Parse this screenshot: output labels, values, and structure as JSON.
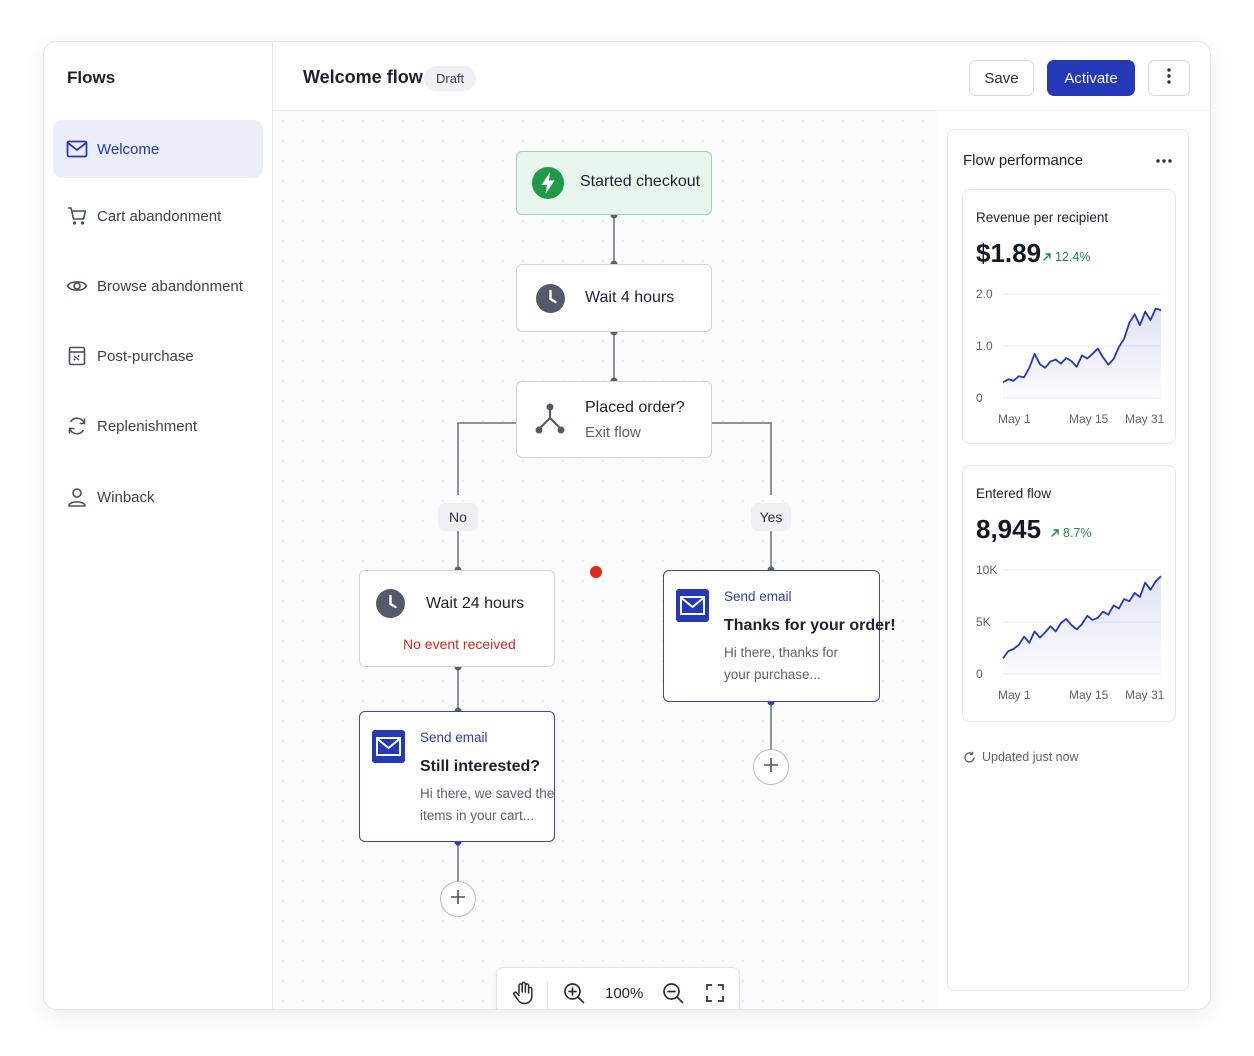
{
  "sidebar": {
    "title": "Flows",
    "items": [
      {
        "label": "Welcome",
        "icon": "mail-icon",
        "active": true
      },
      {
        "label": "Cart abandonment",
        "icon": "cart-icon"
      },
      {
        "label": "Browse abandonment",
        "icon": "eye-icon"
      },
      {
        "label": "Post-purchase",
        "icon": "receipt-icon"
      },
      {
        "label": "Replenishment",
        "icon": "refresh-icon"
      },
      {
        "label": "Winback",
        "icon": "user-icon"
      }
    ]
  },
  "header": {
    "title": "Welcome flow",
    "status": "Draft",
    "save_label": "Save",
    "activate_label": "Activate",
    "more_icon": "more-vertical-icon"
  },
  "colors": {
    "accent": "#2438b8",
    "trigger_bg": "#e8f6ee",
    "trigger_icon": "#1f9a48",
    "alert": "#e0291c",
    "positive": "#1f8a3f"
  },
  "flow": {
    "trigger": {
      "label": "Started checkout",
      "icon": "lightning-icon"
    },
    "wait1": {
      "label": "Wait 4 hours",
      "icon": "clock-icon"
    },
    "split": {
      "title": "Placed order?",
      "subtitle": "Exit flow",
      "icon": "split-icon"
    },
    "branch_no": "No",
    "branch_yes": "Yes",
    "wait2": {
      "label": "Wait 24 hours",
      "status": "No event received",
      "icon": "clock-icon"
    },
    "email_no": {
      "kicker": "Send email",
      "subject": "Still interested?",
      "preview_line1": "Hi there, we saved the",
      "preview_line2": "items in your cart..."
    },
    "email_yes": {
      "kicker": "Send email",
      "subject": "Thanks for your order!",
      "preview_line1": "Hi there, thanks for",
      "preview_line2": "your purchase..."
    }
  },
  "canvas_toolbar": {
    "zoom": "100%",
    "tools": [
      "hand-icon",
      "zoom-in-icon",
      "zoom-out-icon",
      "fullscreen-icon"
    ]
  },
  "performance": {
    "title": "Flow performance",
    "updated": "Updated just now"
  },
  "chart_data": [
    {
      "type": "area",
      "title": "Revenue per recipient",
      "value": "$1.89",
      "delta": "12.4%",
      "ylim": [
        0,
        2.0
      ],
      "yticks": [
        "2.0",
        "1.0",
        "0"
      ],
      "xticks": [
        "May 1",
        "May 15",
        "May 31"
      ],
      "x": [
        1,
        2,
        3,
        4,
        5,
        6,
        7,
        8,
        9,
        10,
        11,
        12,
        13,
        14,
        15,
        16,
        17,
        18,
        19,
        20,
        21,
        22,
        23,
        24,
        25,
        26,
        27,
        28,
        29,
        30,
        31
      ],
      "values": [
        0.3,
        0.36,
        0.33,
        0.42,
        0.4,
        0.58,
        0.85,
        0.65,
        0.58,
        0.7,
        0.74,
        0.66,
        0.77,
        0.71,
        0.6,
        0.82,
        0.76,
        0.85,
        0.95,
        0.78,
        0.64,
        0.75,
        0.98,
        1.14,
        1.45,
        1.61,
        1.4,
        1.66,
        1.5,
        1.72,
        1.69
      ]
    },
    {
      "type": "area",
      "title": "Entered flow",
      "value": "8,945",
      "delta": "8.7%",
      "ylim": [
        0,
        10000
      ],
      "yticks": [
        "10K",
        "5K",
        "0"
      ],
      "xticks": [
        "May 1",
        "May 15",
        "May 31"
      ],
      "x": [
        1,
        2,
        3,
        4,
        5,
        6,
        7,
        8,
        9,
        10,
        11,
        12,
        13,
        14,
        15,
        16,
        17,
        18,
        19,
        20,
        21,
        22,
        23,
        24,
        25,
        26,
        27,
        28,
        29,
        30,
        31
      ],
      "values": [
        1500,
        2200,
        2400,
        2800,
        3600,
        3000,
        4100,
        3500,
        4000,
        4600,
        4100,
        4900,
        5300,
        4700,
        4300,
        4800,
        5600,
        5200,
        5400,
        6000,
        5700,
        6600,
        6300,
        7200,
        7000,
        7800,
        7400,
        8800,
        8100,
        8900,
        9400
      ]
    }
  ]
}
